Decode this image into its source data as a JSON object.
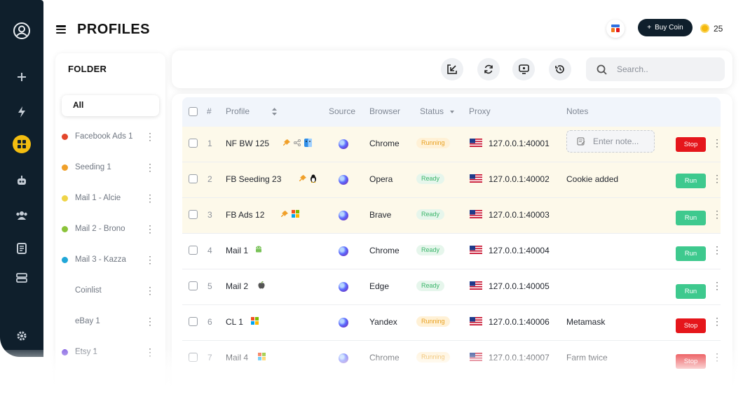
{
  "header": {
    "title": "PROFILES",
    "buy_label": "Buy Coin",
    "buy_plus": "+",
    "coin_count": "25"
  },
  "rail": {
    "icons": [
      "user-circle-icon",
      "plus-icon",
      "bolt-icon",
      "grid-icon",
      "robot-icon",
      "team-icon",
      "document-icon",
      "server-icon",
      "settings-icon",
      "link-icon"
    ]
  },
  "folders": {
    "title": "FOLDER",
    "all_label": "All",
    "items": [
      {
        "label": "Facebook Ads 1",
        "color": "#e3462b"
      },
      {
        "label": "Seeding 1",
        "color": "#f0a02a"
      },
      {
        "label": "Mail 1 - Alcie",
        "color": "#efd447"
      },
      {
        "label": "Mail 2 - Brono",
        "color": "#8bc33a"
      },
      {
        "label": "Mail 3 - Kazza",
        "color": "#21a7d8"
      },
      {
        "label": "Coinlist",
        "color": ""
      },
      {
        "label": "eBay 1",
        "color": ""
      },
      {
        "label": "Etsy 1",
        "color": "#7a55e0"
      }
    ]
  },
  "search": {
    "placeholder": "Search.."
  },
  "table": {
    "headers": {
      "index": "#",
      "profile": "Profile",
      "source": "Source",
      "browser": "Browser",
      "status": "Status",
      "proxy": "Proxy",
      "notes": "Notes"
    },
    "note_placeholder": "Enter note...",
    "rows": [
      {
        "num": "1",
        "profile": "NF BW 125",
        "icons": [
          "pin",
          "share",
          "finder"
        ],
        "browser": "Chrome",
        "status": "Running",
        "proxy": "127.0.0.1:40001",
        "notes": "",
        "action": "Stop",
        "highlight": true
      },
      {
        "num": "2",
        "profile": "FB Seeding 23",
        "icons": [
          "pin",
          "linux"
        ],
        "browser": "Opera",
        "status": "Ready",
        "proxy": "127.0.0.1:40002",
        "notes": "Cookie added",
        "action": "Run",
        "highlight": true
      },
      {
        "num": "3",
        "profile": "FB Ads 12",
        "icons": [
          "pin",
          "windows"
        ],
        "browser": "Brave",
        "status": "Ready",
        "proxy": "127.0.0.1:40003",
        "notes": "",
        "action": "Run",
        "highlight": true
      },
      {
        "num": "4",
        "profile": "Mail 1",
        "icons": [
          "android"
        ],
        "browser": "Chrome",
        "status": "Ready",
        "proxy": "127.0.0.1:40004",
        "notes": "",
        "action": "Run",
        "highlight": false
      },
      {
        "num": "5",
        "profile": "Mail 2",
        "icons": [
          "apple"
        ],
        "browser": "Edge",
        "status": "Ready",
        "proxy": "127.0.0.1:40005",
        "notes": "",
        "action": "Run",
        "highlight": false
      },
      {
        "num": "6",
        "profile": "CL 1",
        "icons": [
          "windows"
        ],
        "browser": "Yandex",
        "status": "Running",
        "proxy": "127.0.0.1:40006",
        "notes": "Metamask",
        "action": "Stop",
        "highlight": false
      },
      {
        "num": "7",
        "profile": "Mail 4",
        "icons": [
          "windows"
        ],
        "browser": "Chrome",
        "status": "Running",
        "proxy": "127.0.0.1:40007",
        "notes": "Farm twice",
        "action": "Stop",
        "highlight": false
      }
    ]
  },
  "colors": {
    "rail": "#0f1f2c",
    "accent_active": "#f3bd10",
    "stop": "#e5161b",
    "run": "#3ec98e"
  }
}
